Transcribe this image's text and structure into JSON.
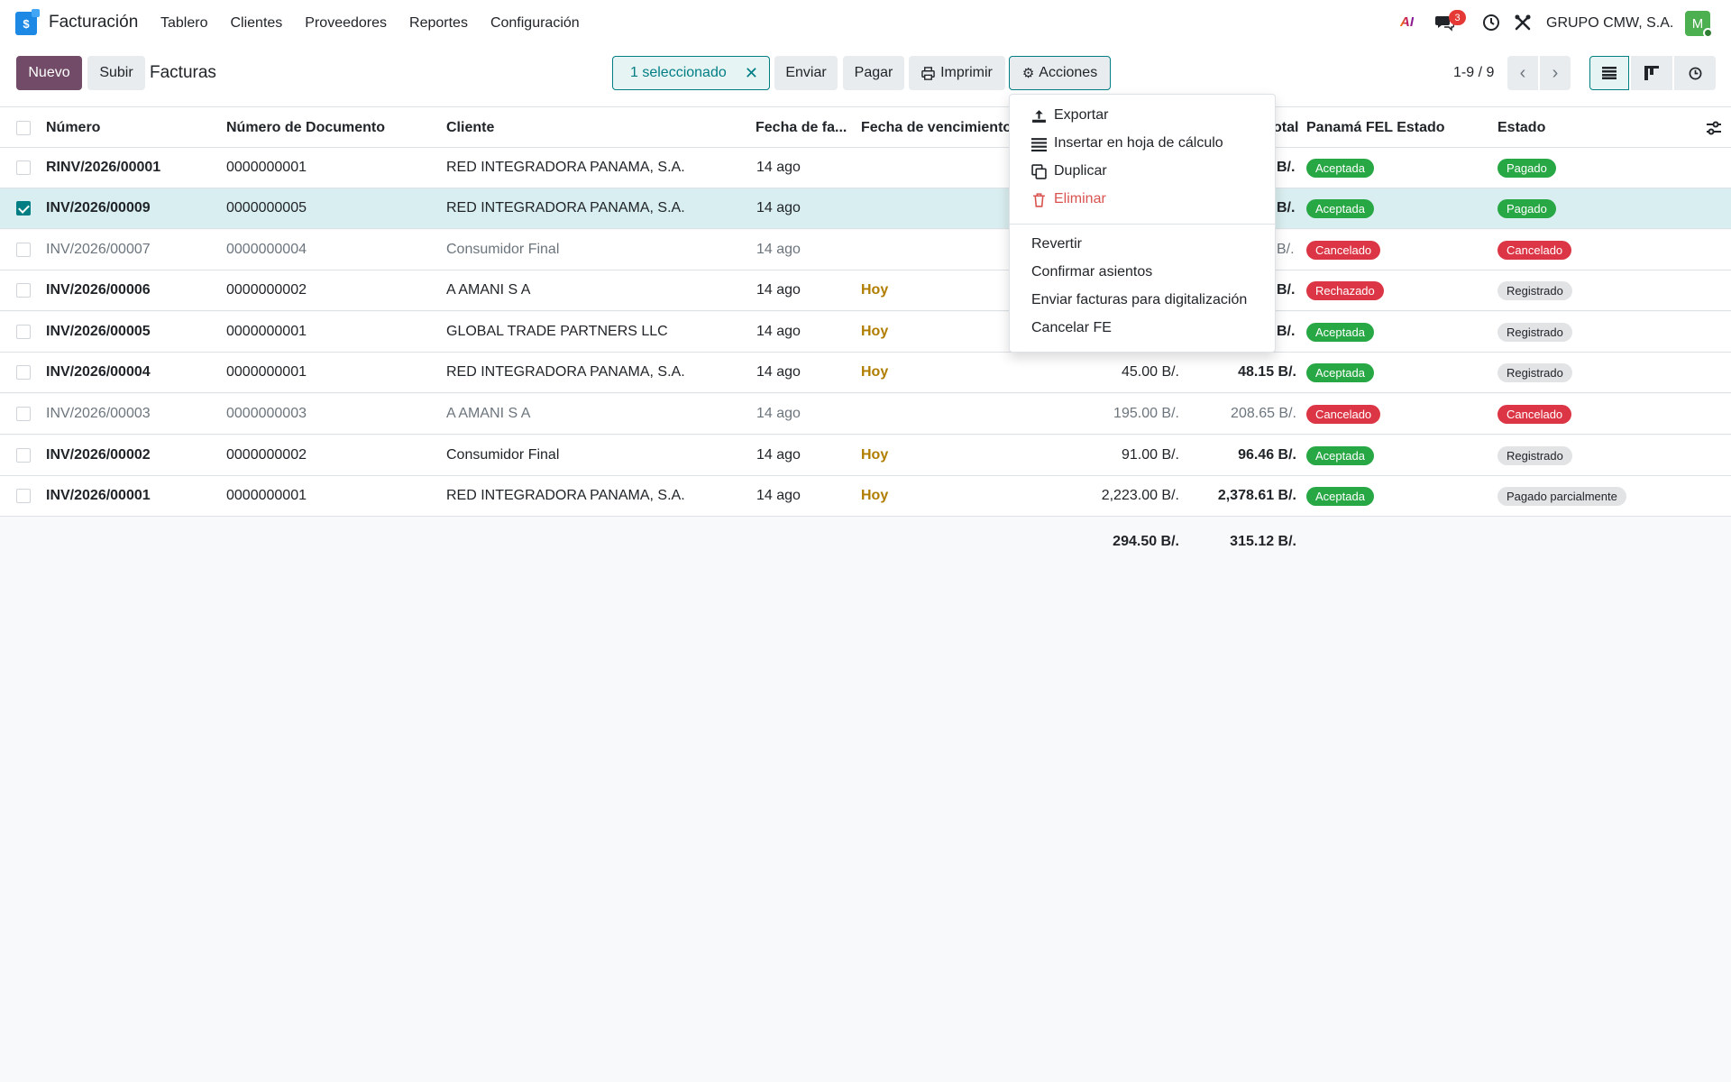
{
  "navbar": {
    "app_name": "Facturación",
    "menu": [
      "Tablero",
      "Clientes",
      "Proveedores",
      "Reportes",
      "Configuración"
    ],
    "ai_label": "AI",
    "chat_count": "3",
    "company": "GRUPO CMW, S.A.",
    "avatar_letter": "M"
  },
  "control": {
    "new_label": "Nuevo",
    "upload_label": "Subir",
    "breadcrumb": "Facturas",
    "selected_label": "1 seleccionado",
    "send_label": "Enviar",
    "pay_label": "Pagar",
    "print_label": "Imprimir",
    "actions_label": "Acciones",
    "pager": "1-9 / 9"
  },
  "table": {
    "headers": {
      "numero": "Número",
      "documento": "Número de Documento",
      "cliente": "Cliente",
      "fecha": "Fecha de fa...",
      "vencimiento": "Fecha de vencimiento",
      "total": "otal",
      "fel": "Panamá FEL Estado",
      "estado": "Estado"
    },
    "rows": [
      {
        "numero": "RINV/2026/00001",
        "doc": "0000000001",
        "cliente": "RED INTEGRADORA PANAMA, S.A.",
        "fecha": "14 ago",
        "venc": "",
        "base": "",
        "total": "B/.",
        "fel": "Aceptada",
        "estado": "Pagado"
      },
      {
        "numero": "INV/2026/00009",
        "doc": "0000000005",
        "cliente": "RED INTEGRADORA PANAMA, S.A.",
        "fecha": "14 ago",
        "venc": "",
        "base": "",
        "total": "B/.",
        "fel": "Aceptada",
        "estado": "Pagado"
      },
      {
        "numero": "INV/2026/00007",
        "doc": "0000000004",
        "cliente": "Consumidor Final",
        "fecha": "14 ago",
        "venc": "",
        "base": "",
        "total": "B/.",
        "fel": "Cancelado",
        "estado": "Cancelado"
      },
      {
        "numero": "INV/2026/00006",
        "doc": "0000000002",
        "cliente": "A AMANI S A",
        "fecha": "14 ago",
        "venc": "Hoy",
        "base": "",
        "total": "B/.",
        "fel": "Rechazado",
        "estado": "Registrado"
      },
      {
        "numero": "INV/2026/00005",
        "doc": "0000000001",
        "cliente": "GLOBAL TRADE PARTNERS LLC",
        "fecha": "14 ago",
        "venc": "Hoy",
        "base": "",
        "total": "B/.",
        "fel": "Aceptada",
        "estado": "Registrado"
      },
      {
        "numero": "INV/2026/00004",
        "doc": "0000000001",
        "cliente": "RED INTEGRADORA PANAMA, S.A.",
        "fecha": "14 ago",
        "venc": "Hoy",
        "base": "45.00 B/.",
        "total": "48.15 B/.",
        "fel": "Aceptada",
        "estado": "Registrado"
      },
      {
        "numero": "INV/2026/00003",
        "doc": "0000000003",
        "cliente": "A AMANI S A",
        "fecha": "14 ago",
        "venc": "",
        "base": "195.00 B/.",
        "total": "208.65 B/.",
        "fel": "Cancelado",
        "estado": "Cancelado"
      },
      {
        "numero": "INV/2026/00002",
        "doc": "0000000002",
        "cliente": "Consumidor Final",
        "fecha": "14 ago",
        "venc": "Hoy",
        "base": "91.00 B/.",
        "total": "96.46 B/.",
        "fel": "Aceptada",
        "estado": "Registrado"
      },
      {
        "numero": "INV/2026/00001",
        "doc": "0000000001",
        "cliente": "RED INTEGRADORA PANAMA, S.A.",
        "fecha": "14 ago",
        "venc": "Hoy",
        "base": "2,223.00 B/.",
        "total": "2,378.61 B/.",
        "fel": "Aceptada",
        "estado": "Pagado parcialmente"
      }
    ],
    "totals": {
      "base": "294.50 B/.",
      "total": "315.12 B/."
    }
  },
  "dropdown": {
    "export": "Exportar",
    "spreadsheet": "Insertar en hoja de cálculo",
    "duplicate": "Duplicar",
    "delete": "Eliminar",
    "revert": "Revertir",
    "confirm": "Confirmar asientos",
    "digitize": "Enviar facturas para digitalización",
    "cancel_fe": "Cancelar FE"
  },
  "colors": {
    "primary": "#714b67",
    "accent": "#017e84",
    "success": "#28a745",
    "danger": "#dc3545"
  }
}
